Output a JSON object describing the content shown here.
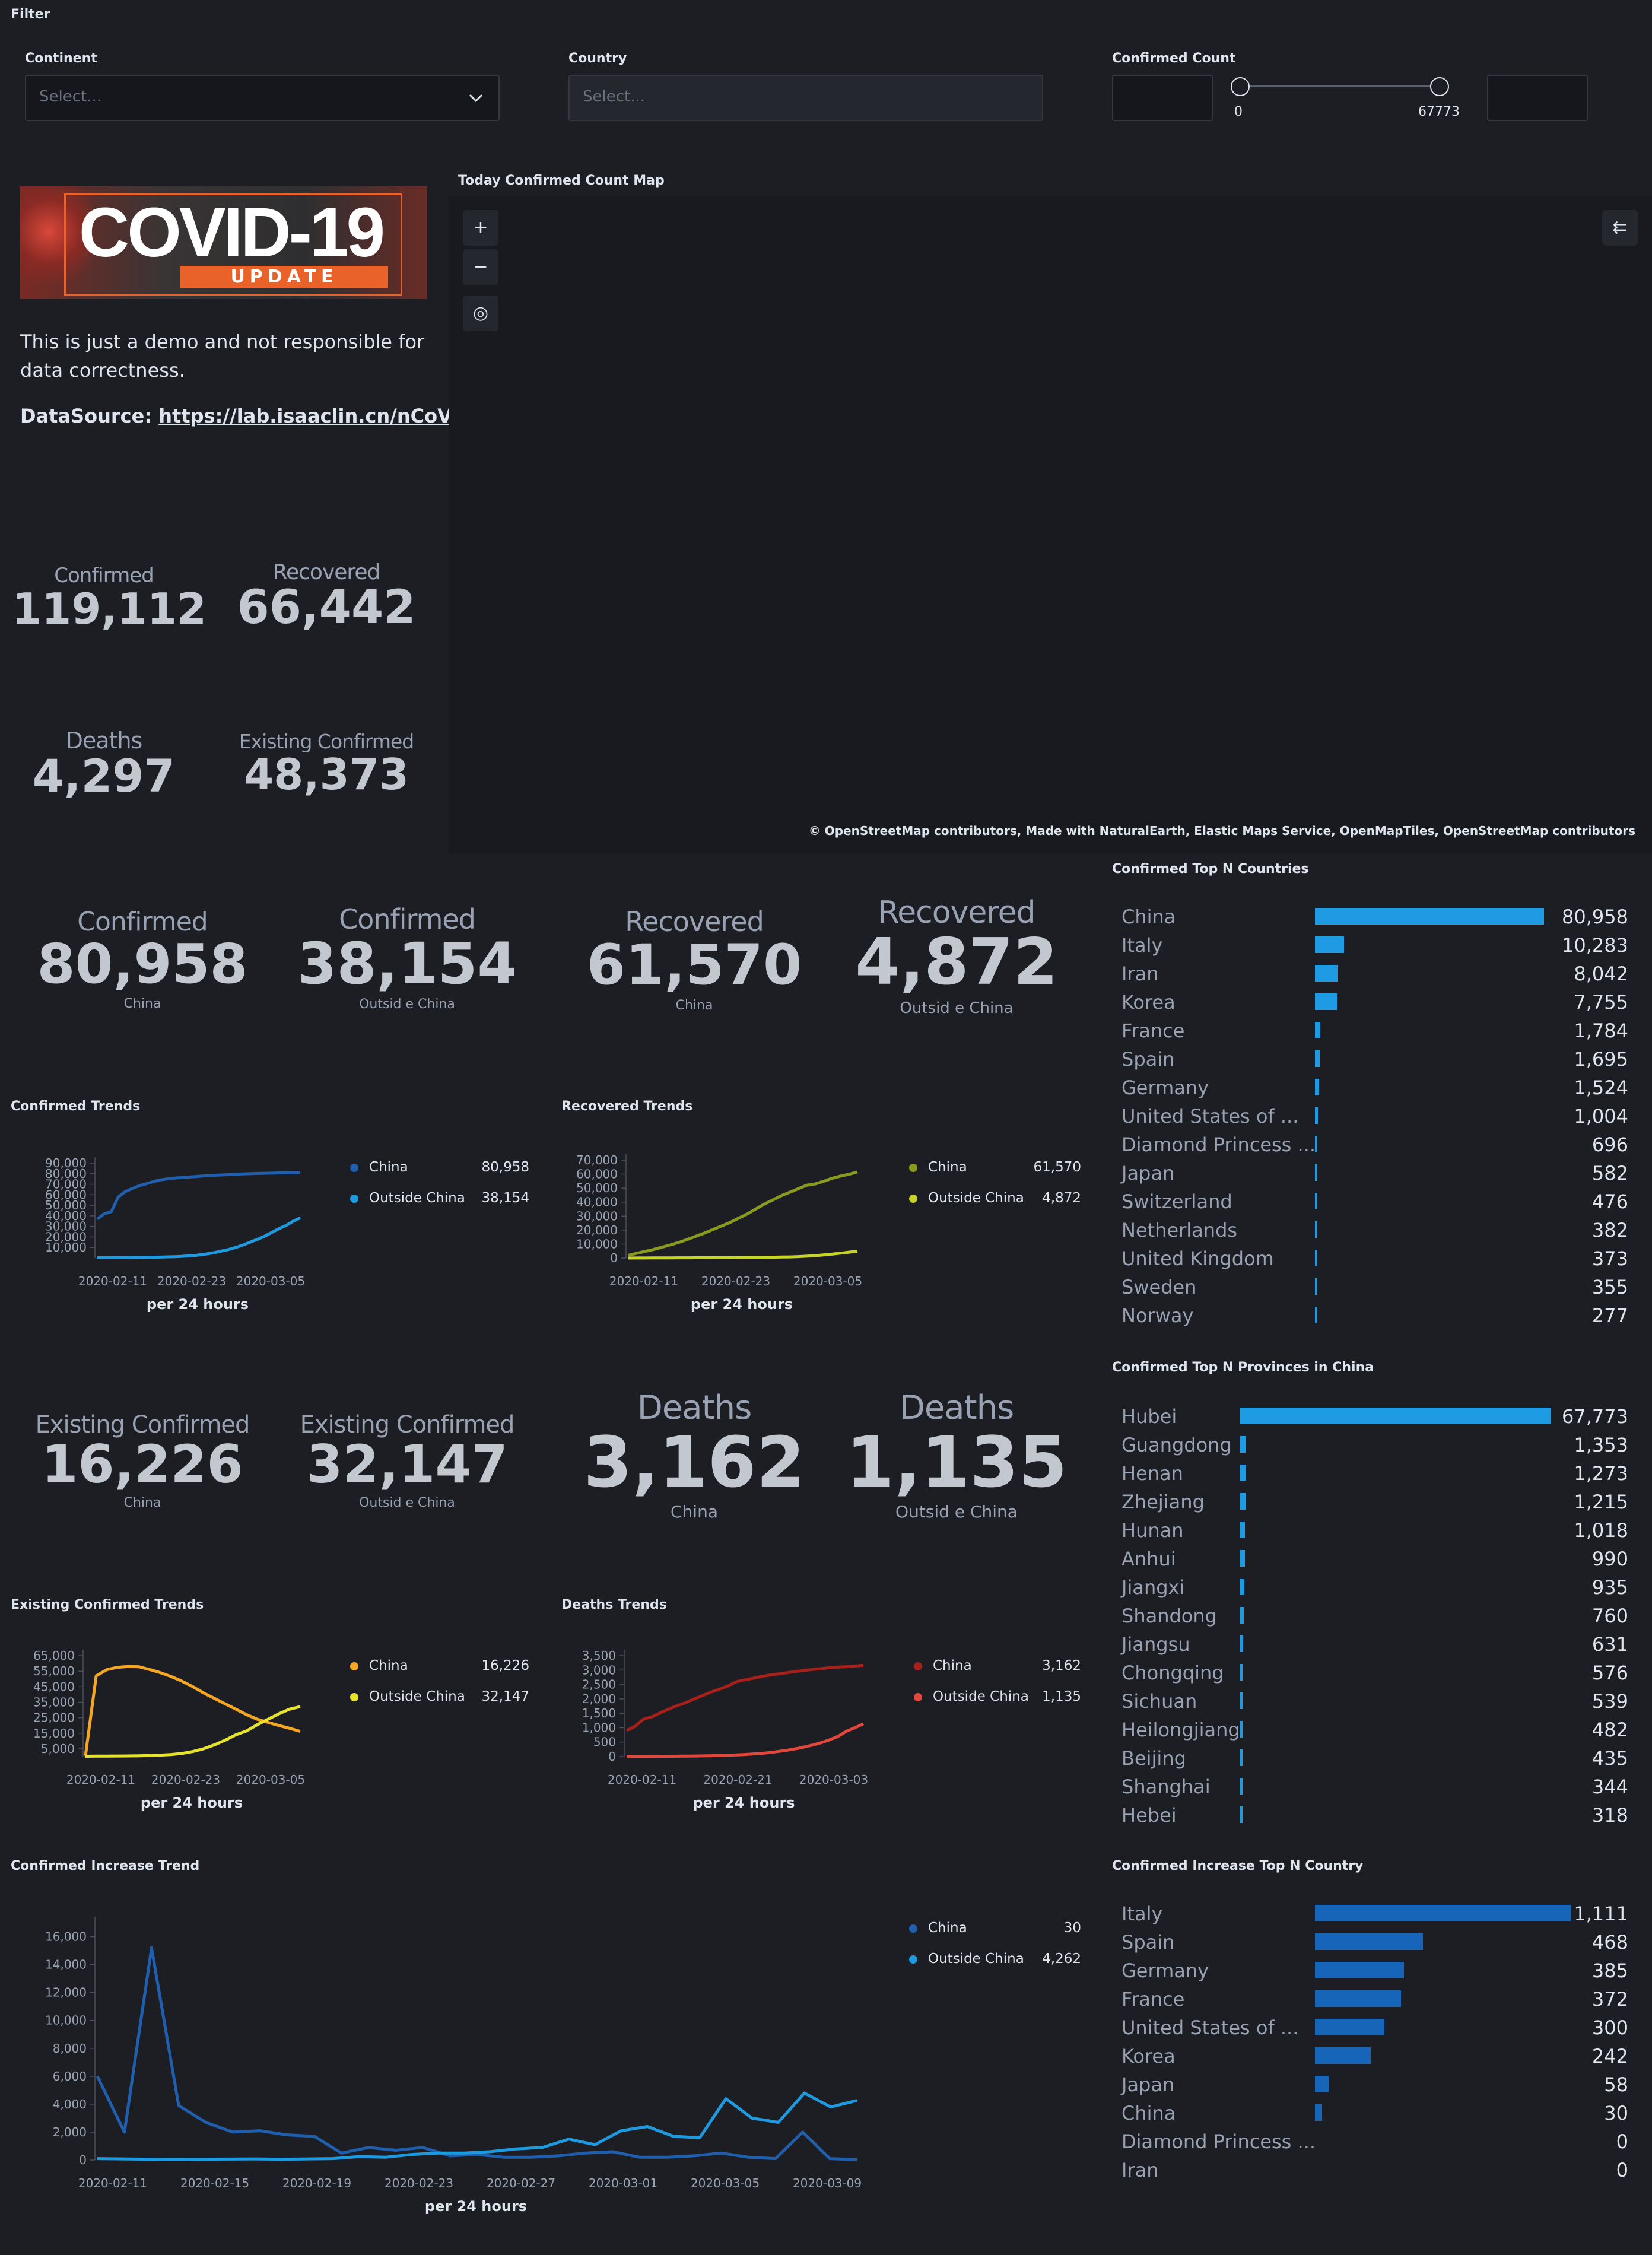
{
  "filter": {
    "title": "Filter",
    "continent_label": "Continent",
    "continent_placeholder": "Select...",
    "country_label": "Country",
    "country_placeholder": "Select...",
    "count_label": "Confirmed Count",
    "range_min": "0",
    "range_max": "67773"
  },
  "banner": {
    "title": "COVID-19",
    "subtitle": "UPDATE"
  },
  "info": {
    "disclaimer": "This is just a demo and not responsible for data correctness.",
    "source_label": "DataSource:",
    "source_link": "https://lab.isaaclin.cn/nCoV/"
  },
  "summary": {
    "confirmed_title": "Confirmed",
    "confirmed_value": "119,112",
    "recovered_title": "Recovered",
    "recovered_value": "66,442",
    "deaths_title": "Deaths",
    "deaths_value": "4,297",
    "existing_title": "Existing Confirmed",
    "existing_value": "48,373"
  },
  "map": {
    "title": "Today Confirmed Count Map",
    "attribution": "© OpenStreetMap contributors, Made with NaturalEarth, Elastic Maps Service, OpenMapTiles, OpenStreetMap contributors",
    "zoom_in": "+",
    "zoom_out": "−",
    "locate": "◎",
    "layers": "⇇"
  },
  "metrics_row1": [
    {
      "title": "Confirmed",
      "value": "80,958",
      "sub": "China"
    },
    {
      "title": "Confirmed",
      "value": "38,154",
      "sub": "Outsid e China"
    },
    {
      "title": "Recovered",
      "value": "61,570",
      "sub": "China"
    },
    {
      "title": "Recovered",
      "value": "4,872",
      "sub": "Outsid e China"
    }
  ],
  "metrics_row2": [
    {
      "title": "Existing Confirmed",
      "value": "16,226",
      "sub": "China"
    },
    {
      "title": "Existing Confirmed",
      "value": "32,147",
      "sub": "Outsid e China"
    },
    {
      "title": "Deaths",
      "value": "3,162",
      "sub": "China"
    },
    {
      "title": "Deaths",
      "value": "1,135",
      "sub": "Outsid e China"
    }
  ],
  "trends": {
    "confirmed": {
      "title": "Confirmed Trends",
      "xlabel": "per 24 hours",
      "legend": [
        {
          "name": "China",
          "value": "80,958"
        },
        {
          "name": "Outside China",
          "value": "38,154"
        }
      ]
    },
    "recovered": {
      "title": "Recovered Trends",
      "xlabel": "per 24 hours",
      "legend": [
        {
          "name": "China",
          "value": "61,570"
        },
        {
          "name": "Outside China",
          "value": "4,872"
        }
      ]
    },
    "existing": {
      "title": "Existing Confirmed Trends",
      "xlabel": "per 24 hours",
      "legend": [
        {
          "name": "China",
          "value": "16,226"
        },
        {
          "name": "Outside China",
          "value": "32,147"
        }
      ]
    },
    "deaths": {
      "title": "Deaths Trends",
      "xlabel": "per 24 hours",
      "legend": [
        {
          "name": "China",
          "value": "3,162"
        },
        {
          "name": "Outside China",
          "value": "1,135"
        }
      ]
    },
    "increase": {
      "title": "Confirmed Increase Trend",
      "xlabel": "per 24 hours",
      "legend": [
        {
          "name": "China",
          "value": "30"
        },
        {
          "name": "Outside China",
          "value": "4,262"
        }
      ]
    }
  },
  "top_countries": {
    "title": "Confirmed Top N Countries",
    "items": [
      {
        "name": "China",
        "value": "80,958",
        "num": 80958
      },
      {
        "name": "Italy",
        "value": "10,283",
        "num": 10283
      },
      {
        "name": "Iran",
        "value": "8,042",
        "num": 8042
      },
      {
        "name": "Korea",
        "value": "7,755",
        "num": 7755
      },
      {
        "name": "France",
        "value": "1,784",
        "num": 1784
      },
      {
        "name": "Spain",
        "value": "1,695",
        "num": 1695
      },
      {
        "name": "Germany",
        "value": "1,524",
        "num": 1524
      },
      {
        "name": "United States of ...",
        "value": "1,004",
        "num": 1004
      },
      {
        "name": "Diamond Princess ...",
        "value": "696",
        "num": 696
      },
      {
        "name": "Japan",
        "value": "582",
        "num": 582
      },
      {
        "name": "Switzerland",
        "value": "476",
        "num": 476
      },
      {
        "name": "Netherlands",
        "value": "382",
        "num": 382
      },
      {
        "name": "United Kingdom",
        "value": "373",
        "num": 373
      },
      {
        "name": "Sweden",
        "value": "355",
        "num": 355
      },
      {
        "name": "Norway",
        "value": "277",
        "num": 277
      }
    ]
  },
  "top_provinces": {
    "title": "Confirmed Top N Provinces in China",
    "items": [
      {
        "name": "Hubei",
        "value": "67,773",
        "num": 67773
      },
      {
        "name": "Guangdong",
        "value": "1,353",
        "num": 1353
      },
      {
        "name": "Henan",
        "value": "1,273",
        "num": 1273
      },
      {
        "name": "Zhejiang",
        "value": "1,215",
        "num": 1215
      },
      {
        "name": "Hunan",
        "value": "1,018",
        "num": 1018
      },
      {
        "name": "Anhui",
        "value": "990",
        "num": 990
      },
      {
        "name": "Jiangxi",
        "value": "935",
        "num": 935
      },
      {
        "name": "Shandong",
        "value": "760",
        "num": 760
      },
      {
        "name": "Jiangsu",
        "value": "631",
        "num": 631
      },
      {
        "name": "Chongqing",
        "value": "576",
        "num": 576
      },
      {
        "name": "Sichuan",
        "value": "539",
        "num": 539
      },
      {
        "name": "Heilongjiang",
        "value": "482",
        "num": 482
      },
      {
        "name": "Beijing",
        "value": "435",
        "num": 435
      },
      {
        "name": "Shanghai",
        "value": "344",
        "num": 344
      },
      {
        "name": "Hebei",
        "value": "318",
        "num": 318
      }
    ]
  },
  "top_increase": {
    "title": "Confirmed Increase Top N Country",
    "items": [
      {
        "name": "Italy",
        "value": "1,111",
        "num": 1111
      },
      {
        "name": "Spain",
        "value": "468",
        "num": 468
      },
      {
        "name": "Germany",
        "value": "385",
        "num": 385
      },
      {
        "name": "France",
        "value": "372",
        "num": 372
      },
      {
        "name": "United States of ...",
        "value": "300",
        "num": 300
      },
      {
        "name": "Korea",
        "value": "242",
        "num": 242
      },
      {
        "name": "Japan",
        "value": "58",
        "num": 58
      },
      {
        "name": "China",
        "value": "30",
        "num": 30
      },
      {
        "name": "Diamond Princess ...",
        "value": "0",
        "num": 0
      },
      {
        "name": "Iran",
        "value": "0",
        "num": 0
      }
    ]
  },
  "colors": {
    "china_blue": "#1f5fad",
    "outside_blue": "#1e9be0",
    "china_olive": "#8a9a1f",
    "outside_yellowgreen": "#c6d42a",
    "china_orange": "#f5a623",
    "outside_yellow": "#e7e32c",
    "china_red": "#a8201a",
    "outside_red": "#e2473b",
    "bar_blue": "#1f9be4",
    "bar_darkblue": "#1665b8"
  },
  "chart_data": [
    {
      "type": "line",
      "title": "Confirmed Trends",
      "xlabel": "per 24 hours",
      "x_ticks": [
        "2020-02-11",
        "2020-02-23",
        "2020-03-05"
      ],
      "y_ticks": [
        "10,000",
        "20,000",
        "30,000",
        "40,000",
        "50,000",
        "60,000",
        "70,000",
        "80,000",
        "90,000"
      ],
      "ylim": [
        0,
        90000
      ],
      "series": [
        {
          "name": "China",
          "color": "#1f5fad",
          "values": [
            37000,
            42000,
            44000,
            58000,
            63000,
            66000,
            68500,
            70500,
            72400,
            74100,
            75000,
            75800,
            76300,
            76800,
            77200,
            77800,
            78100,
            78500,
            78800,
            79200,
            79400,
            79800,
            80000,
            80200,
            80400,
            80500,
            80700,
            80800,
            80900,
            80958
          ]
        },
        {
          "name": "Outside China",
          "color": "#1e9be0",
          "values": [
            300,
            350,
            400,
            450,
            500,
            550,
            600,
            700,
            800,
            900,
            1100,
            1300,
            1500,
            2000,
            2500,
            3300,
            4300,
            5500,
            7000,
            8500,
            10500,
            12800,
            15500,
            18000,
            21000,
            24500,
            28000,
            31000,
            35000,
            38154
          ]
        }
      ]
    },
    {
      "type": "line",
      "title": "Recovered Trends",
      "xlabel": "per 24 hours",
      "x_ticks": [
        "2020-02-11",
        "2020-02-23",
        "2020-03-05"
      ],
      "y_ticks": [
        "0",
        "10,000",
        "20,000",
        "30,000",
        "40,000",
        "50,000",
        "60,000",
        "70,000"
      ],
      "ylim": [
        0,
        70000
      ],
      "series": [
        {
          "name": "China",
          "color": "#8a9a1f",
          "values": [
            2000,
            3500,
            4800,
            6200,
            7800,
            9500,
            11300,
            13400,
            15700,
            18000,
            20500,
            23000,
            25500,
            28500,
            31500,
            35000,
            38500,
            41500,
            44500,
            47000,
            49500,
            52000,
            53000,
            54800,
            57000,
            58600,
            59900,
            61570
          ]
        },
        {
          "name": "Outside China",
          "color": "#c6d42a",
          "values": [
            20,
            30,
            50,
            80,
            100,
            130,
            150,
            180,
            200,
            230,
            260,
            300,
            350,
            400,
            450,
            500,
            550,
            600,
            700,
            800,
            1000,
            1300,
            1700,
            2200,
            2800,
            3500,
            4200,
            4872
          ]
        }
      ]
    },
    {
      "type": "line",
      "title": "Existing Confirmed Trends",
      "xlabel": "per 24 hours",
      "x_ticks": [
        "2020-02-11",
        "2020-02-23",
        "2020-03-05"
      ],
      "y_ticks": [
        "5,000",
        "15,000",
        "25,000",
        "35,000",
        "45,000",
        "55,000",
        "65,000"
      ],
      "ylim": [
        0,
        65000
      ],
      "series": [
        {
          "name": "China",
          "color": "#f5a623",
          "values": [
            500,
            52000,
            56000,
            57500,
            58000,
            57800,
            56000,
            54000,
            51500,
            48500,
            45000,
            41000,
            37500,
            34000,
            30500,
            27000,
            24000,
            22000,
            20000,
            18200,
            16226
          ]
        },
        {
          "name": "Outside China",
          "color": "#e7e32c",
          "values": [
            200,
            250,
            300,
            350,
            400,
            500,
            700,
            900,
            1300,
            2000,
            3200,
            5000,
            7500,
            10500,
            14000,
            16500,
            20500,
            24000,
            27500,
            30500,
            32147
          ]
        }
      ]
    },
    {
      "type": "line",
      "title": "Deaths Trends",
      "xlabel": "per 24 hours",
      "x_ticks": [
        "2020-02-11",
        "2020-02-21",
        "2020-03-03"
      ],
      "y_ticks": [
        "0",
        "500",
        "1,000",
        "1,500",
        "2,000",
        "2,500",
        "3,000",
        "3,500"
      ],
      "ylim": [
        0,
        3500
      ],
      "series": [
        {
          "name": "China",
          "color": "#a8201a",
          "values": [
            900,
            1050,
            1300,
            1380,
            1520,
            1650,
            1770,
            1870,
            2000,
            2120,
            2240,
            2340,
            2450,
            2600,
            2660,
            2720,
            2780,
            2830,
            2870,
            2910,
            2950,
            2990,
            3020,
            3050,
            3080,
            3100,
            3120,
            3140,
            3162
          ]
        },
        {
          "name": "Outside China",
          "color": "#e2473b",
          "values": [
            3,
            4,
            5,
            6,
            8,
            10,
            12,
            15,
            18,
            22,
            28,
            35,
            45,
            55,
            70,
            90,
            110,
            140,
            180,
            220,
            270,
            330,
            400,
            480,
            580,
            700,
            880,
            1000,
            1135
          ]
        }
      ]
    },
    {
      "type": "line",
      "title": "Confirmed Increase Trend",
      "xlabel": "per 24 hours",
      "x_ticks": [
        "2020-02-11",
        "2020-02-15",
        "2020-02-19",
        "2020-02-23",
        "2020-02-27",
        "2020-03-01",
        "2020-03-05",
        "2020-03-09"
      ],
      "y_ticks": [
        "0",
        "2,000",
        "4,000",
        "6,000",
        "8,000",
        "10,000",
        "12,000",
        "14,000",
        "16,000"
      ],
      "ylim": [
        0,
        17000
      ],
      "series": [
        {
          "name": "China",
          "color": "#1f5fad",
          "values": [
            6000,
            2000,
            15200,
            3900,
            2700,
            2000,
            2100,
            1800,
            1700,
            500,
            900,
            700,
            900,
            300,
            400,
            200,
            200,
            300,
            500,
            600,
            200,
            200,
            300,
            500,
            200,
            100,
            2000,
            100,
            30
          ]
        },
        {
          "name": "Outside China",
          "color": "#1e9be0",
          "values": [
            100,
            80,
            60,
            50,
            60,
            70,
            80,
            60,
            80,
            100,
            250,
            200,
            400,
            500,
            500,
            600,
            800,
            900,
            1500,
            1100,
            2100,
            2400,
            1700,
            1600,
            4400,
            3000,
            2700,
            4800,
            3800,
            4262
          ]
        }
      ]
    },
    {
      "type": "bar",
      "title": "Confirmed Top N Countries",
      "categories": [
        "China",
        "Italy",
        "Iran",
        "Korea",
        "France",
        "Spain",
        "Germany",
        "United States of ...",
        "Diamond Princess ...",
        "Japan",
        "Switzerland",
        "Netherlands",
        "United Kingdom",
        "Sweden",
        "Norway"
      ],
      "values": [
        80958,
        10283,
        8042,
        7755,
        1784,
        1695,
        1524,
        1004,
        696,
        582,
        476,
        382,
        373,
        355,
        277
      ]
    },
    {
      "type": "bar",
      "title": "Confirmed Top N Provinces in China",
      "categories": [
        "Hubei",
        "Guangdong",
        "Henan",
        "Zhejiang",
        "Hunan",
        "Anhui",
        "Jiangxi",
        "Shandong",
        "Jiangsu",
        "Chongqing",
        "Sichuan",
        "Heilongjiang",
        "Beijing",
        "Shanghai",
        "Hebei"
      ],
      "values": [
        67773,
        1353,
        1273,
        1215,
        1018,
        990,
        935,
        760,
        631,
        576,
        539,
        482,
        435,
        344,
        318
      ]
    },
    {
      "type": "bar",
      "title": "Confirmed Increase Top N Country",
      "categories": [
        "Italy",
        "Spain",
        "Germany",
        "France",
        "United States of ...",
        "Korea",
        "Japan",
        "China",
        "Diamond Princess ...",
        "Iran"
      ],
      "values": [
        1111,
        468,
        385,
        372,
        300,
        242,
        58,
        30,
        0,
        0
      ]
    }
  ]
}
